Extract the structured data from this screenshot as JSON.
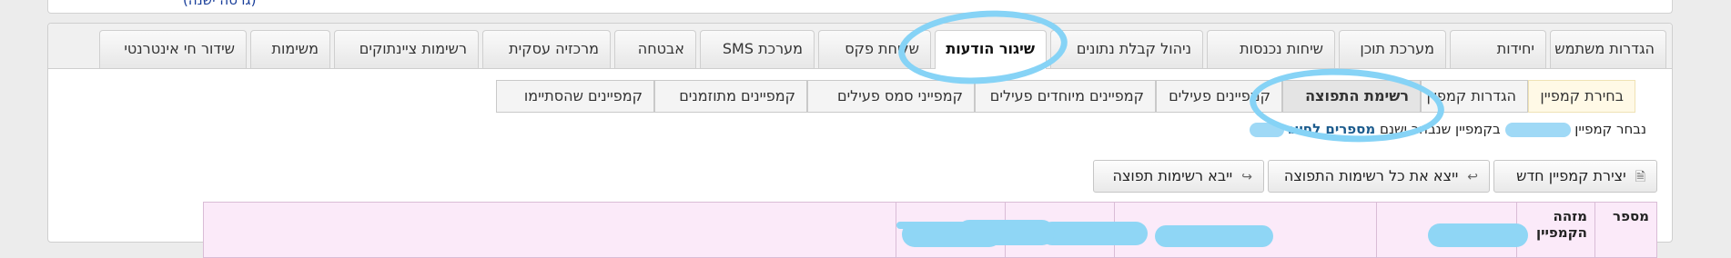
{
  "header": {
    "old_version_link": "(גרסה ישנה)"
  },
  "tabs": [
    {
      "label": "הגדרות משתמש"
    },
    {
      "label": "יחידות"
    },
    {
      "label": "מערכת תוכן"
    },
    {
      "label": "שיחות נכנסות"
    },
    {
      "label": "ניהול קבלת נתונים"
    },
    {
      "label": "שיגור הודעות",
      "active": true
    },
    {
      "label": "שליחת פקס"
    },
    {
      "label": "מערכת SMS"
    },
    {
      "label": "אבטחה"
    },
    {
      "label": "מרכזיה עסקית"
    },
    {
      "label": "רשימות ציינתוקים"
    },
    {
      "label": "משימות"
    },
    {
      "label": "שידור חי אינטרנטי"
    }
  ],
  "subtabs": [
    {
      "label": "בחירת קמפיין"
    },
    {
      "label": "הגדרות קמפיין"
    },
    {
      "label": "רשימת התפוצה",
      "selected": true
    },
    {
      "label": "קמפיינים פעילים"
    },
    {
      "label": "קמפיינים מיוחדים פעילים"
    },
    {
      "label": "קמפייני סמס פעילים"
    },
    {
      "label": "קמפיינים מתוזמנים"
    },
    {
      "label": "קמפיינים שהסתיימו"
    }
  ],
  "info": {
    "prefix": "נבחר קמפיין",
    "middle": "בקמפיין שנבחר ישנם",
    "highlight": "מספרים לחיוג"
  },
  "buttons": {
    "new_campaign": "יצירת קמפיין חדש",
    "export_all": "ייצא את כל רשימות התפוצה",
    "import": "ייבא רשימות תפוצה"
  },
  "table": {
    "headers": [
      "מספר",
      "מזהה הקמפיין"
    ]
  },
  "colors": {
    "annotation": "#86d3f6",
    "header_bg": "#fbeaf9"
  }
}
